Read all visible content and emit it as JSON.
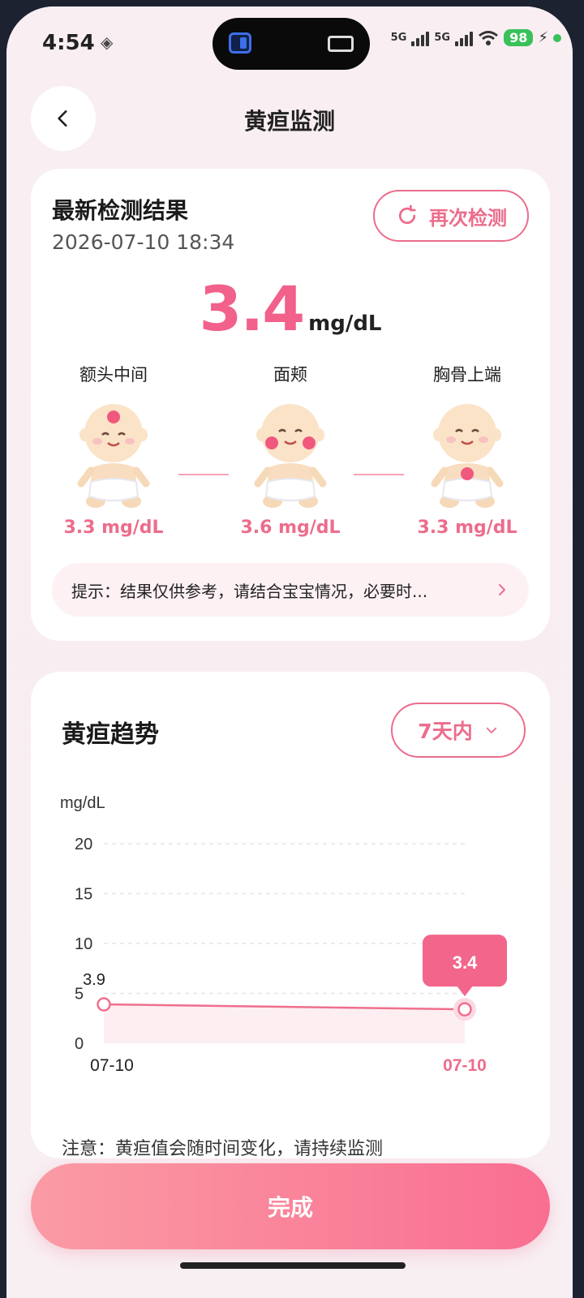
{
  "status_bar": {
    "time": "4:54",
    "network_1": "5G",
    "network_2": "5G",
    "battery": "98"
  },
  "header": {
    "title": "黄疸监测"
  },
  "latest": {
    "title": "最新检测结果",
    "time": "2026-07-10 18:34",
    "retest_label": "再次检测",
    "value": "3.4",
    "unit": "mg/dL",
    "spots": [
      {
        "label": "额头中间",
        "value": "3.3 mg/dL",
        "marker": "forehead"
      },
      {
        "label": "面颊",
        "value": "3.6 mg/dL",
        "marker": "cheeks"
      },
      {
        "label": "胸骨上端",
        "value": "3.3 mg/dL",
        "marker": "chest"
      }
    ],
    "tip": "提示：结果仅供参考，请结合宝宝情况，必要时..."
  },
  "trend": {
    "title": "黄疸趋势",
    "range_label": "7天内",
    "note": "注意：黄疸值会随时间变化，请持续监测"
  },
  "chart_data": {
    "type": "line",
    "ylabel": "mg/dL",
    "ylim": [
      0,
      20
    ],
    "yticks": [
      0,
      5,
      10,
      15,
      20
    ],
    "x": [
      "07-10",
      "07-10"
    ],
    "series": [
      {
        "values": [
          3.9,
          3.4
        ]
      }
    ],
    "data_labels": [
      "3.9",
      "3.4"
    ],
    "highlight_index": 1,
    "grid": true
  },
  "colors": {
    "accent": "#ec6d8c",
    "value": "#f1618a",
    "line": "#ef6f8d"
  },
  "footer": {
    "done_label": "完成"
  }
}
